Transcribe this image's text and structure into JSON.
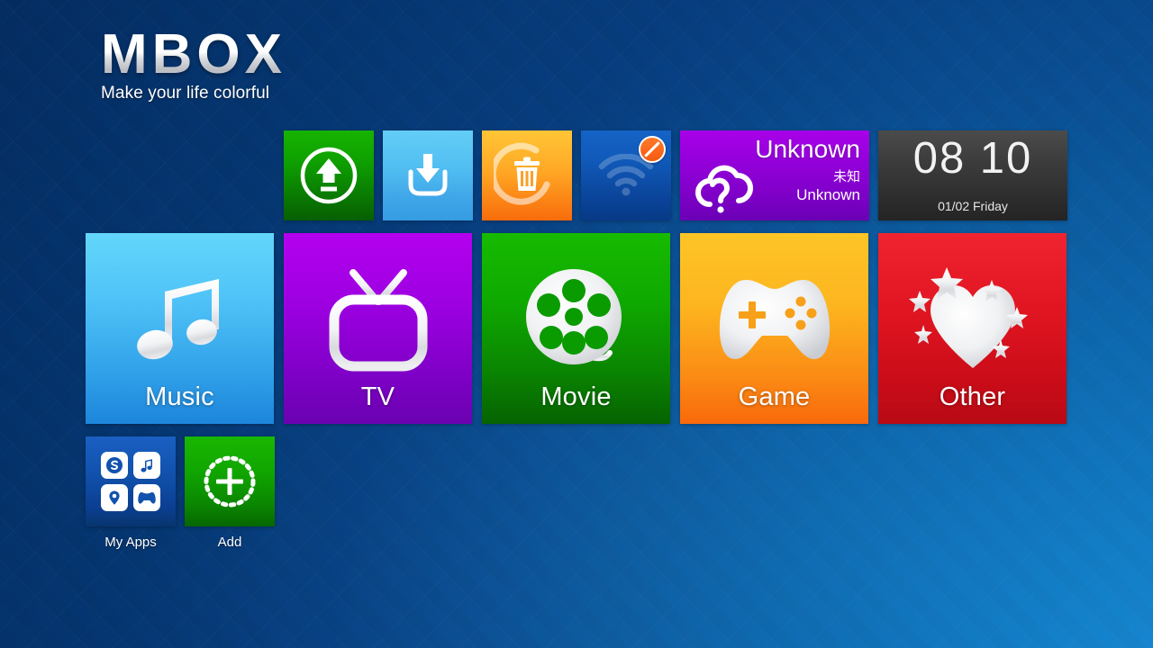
{
  "brand": {
    "name": "MBOX",
    "tagline": "Make your life colorful"
  },
  "top_row": [
    {
      "id": "upgrade",
      "icon": "upload-circle-icon",
      "label": "",
      "color": "#0ea000"
    },
    {
      "id": "download",
      "icon": "download-tray-icon",
      "label": "",
      "color": "#52bff2"
    },
    {
      "id": "cleanup",
      "icon": "trash-ring-icon",
      "label": "",
      "color": "#ffa825"
    },
    {
      "id": "wifi",
      "icon": "wifi-icon",
      "label": "",
      "color": "#1059b8",
      "badge": "disabled-badge",
      "focused": true
    }
  ],
  "weather": {
    "city": "Unknown",
    "city_cn": "未知",
    "condition": "Unknown",
    "icon": "cloud-question-icon",
    "color": "#9100d8"
  },
  "clock": {
    "time": "08 10",
    "date": "01/02 Friday",
    "color": "#3c3c3c"
  },
  "main_row": [
    {
      "id": "music",
      "label": "Music",
      "icon": "music-note-icon",
      "color": "#4fc3f7"
    },
    {
      "id": "tv",
      "label": "TV",
      "icon": "television-icon",
      "color": "#9c00e0"
    },
    {
      "id": "movie",
      "label": "Movie",
      "icon": "film-reel-icon",
      "color": "#0faa00"
    },
    {
      "id": "game",
      "label": "Game",
      "icon": "gamepad-icon",
      "color": "#fdb51f"
    },
    {
      "id": "other",
      "label": "Other",
      "icon": "heart-stars-icon",
      "color": "#e21622"
    }
  ],
  "bottom_row": [
    {
      "id": "my-apps",
      "label": "My Apps",
      "icon": "app-grid-icon",
      "color": "#1152ae"
    },
    {
      "id": "add",
      "label": "Add",
      "icon": "plus-circle-icon",
      "color": "#10a500"
    }
  ],
  "app_grid_icons": [
    "skype-icon",
    "music-note-icon",
    "location-pin-icon",
    "gamepad-icon"
  ]
}
